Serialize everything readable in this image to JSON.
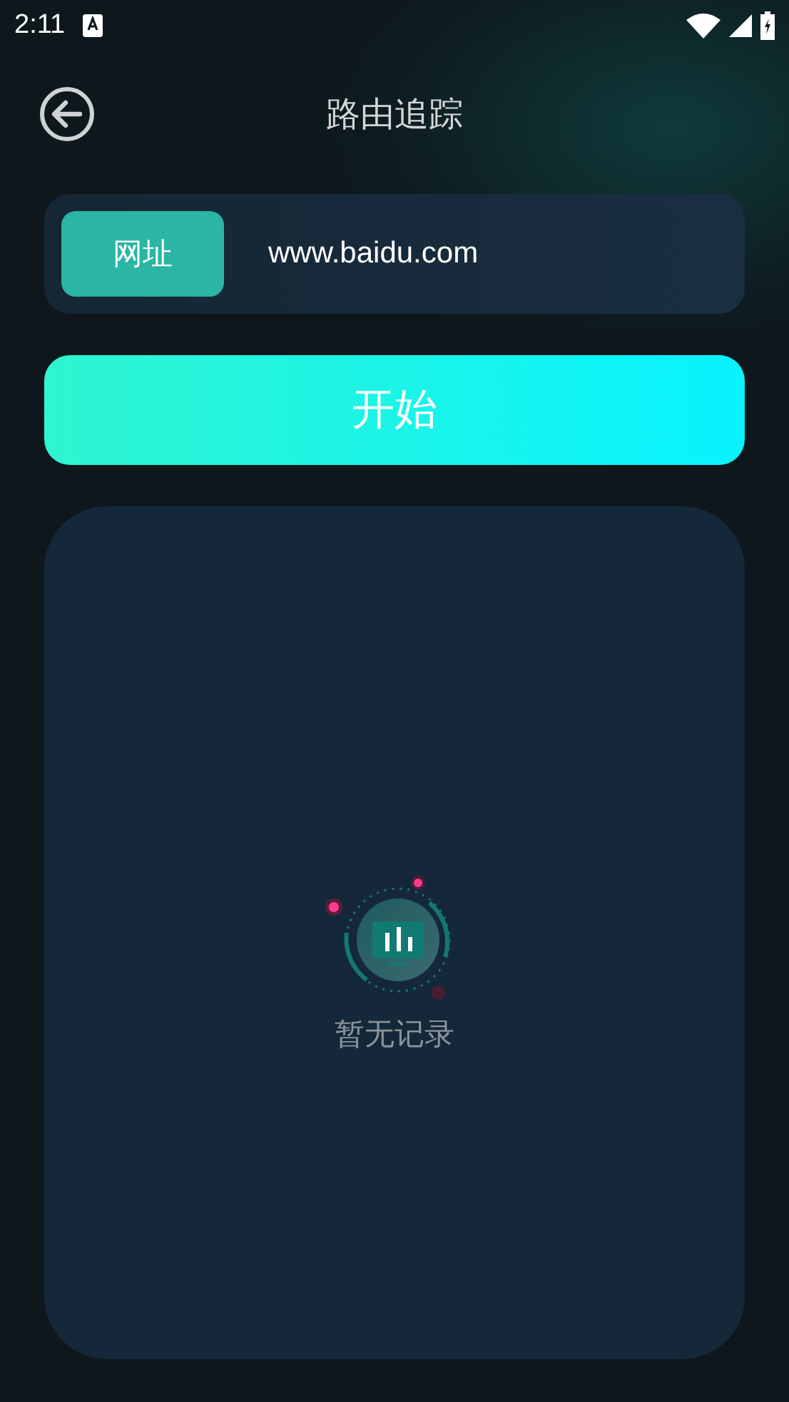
{
  "status_bar": {
    "time": "2:11"
  },
  "header": {
    "title": "路由追踪"
  },
  "url_form": {
    "label": "网址",
    "value": "www.baidu.com"
  },
  "start_button": {
    "label": "开始"
  },
  "records": {
    "empty_text": "暂无记录"
  }
}
